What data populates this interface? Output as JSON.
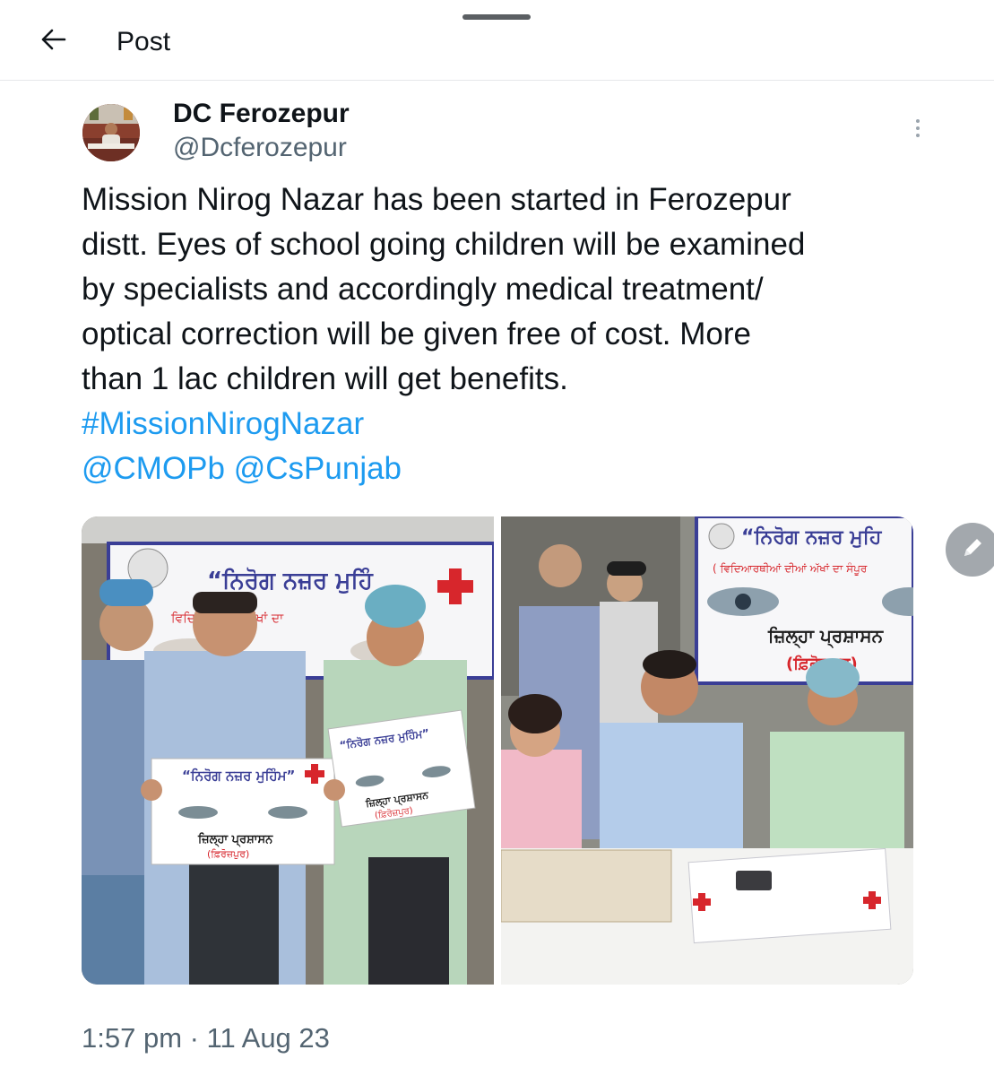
{
  "header": {
    "title": "Post"
  },
  "author": {
    "name": "DC Ferozepur",
    "handle": "@Dcferozepur"
  },
  "tweet": {
    "lines": [
      "Mission Nirog Nazar has been started in Ferozepur",
      "distt. Eyes of school going children will be examined",
      "by specialists and accordingly medical treatment/",
      "optical correction will be given free of cost. More",
      "than 1 lac children will get benefits."
    ],
    "hashtag": "#MissionNirogNazar",
    "mentions": [
      "@CMOPb",
      "@CsPunjab"
    ]
  },
  "media": {
    "photo1": {
      "banner_title": "“ਨਿਰੋਗ ਨਜ਼ਰ ਮੁਹਿੰ",
      "banner_sub": "ਵਿਦਿ ... ਦੀਆਂ ਅੱਖਾਂ ਦਾ",
      "sign_left_title": "“ਨਿਰੋਗ ਨਜ਼ਰ ਮੁਹਿੰਮ”",
      "sign_left_org": "ਜ਼ਿਲ੍ਹਾ ਪ੍ਰਸ਼ਾਸਨ",
      "sign_left_place": "(ਫ਼ਿਰੋਜ਼ਪੁਰ)",
      "sign_right_title": "“ਨਿਰੋਗ ਨਜ਼ਰ ਮੁਹਿੰਮ”",
      "sign_right_org": "ਜ਼ਿਲ੍ਹਾ ਪ੍ਰਸ਼ਾਸਨ",
      "sign_right_place": "(ਫ਼ਿਰੋਜ਼ਪੁਰ)"
    },
    "photo2": {
      "banner_title": "“ਨਿਰੋਗ ਨਜ਼ਰ ਮੁਹਿ",
      "banner_sub": "( ਵਿਦਿਆਰਥੀਆਂ ਦੀਆਂ ਅੱਖਾਂ ਦਾ ਸੰਪੂਰ",
      "banner_org": "ਜ਼ਿਲ੍ਹਾ ਪ੍ਰਸ਼ਾਸਨ",
      "banner_place": "(ਫ਼ਿਰੋਜ਼ਪੁਰ)"
    }
  },
  "timestamp": "1:57 pm · 11 Aug 23",
  "colors": {
    "link": "#1d9bf0",
    "secondary_text": "#536471",
    "banner_red": "#d7262c",
    "banner_blue": "#3a3e96"
  },
  "icons": {
    "back": "arrow-left-icon",
    "more": "more-vertical-icon",
    "edit": "pencil-icon"
  }
}
